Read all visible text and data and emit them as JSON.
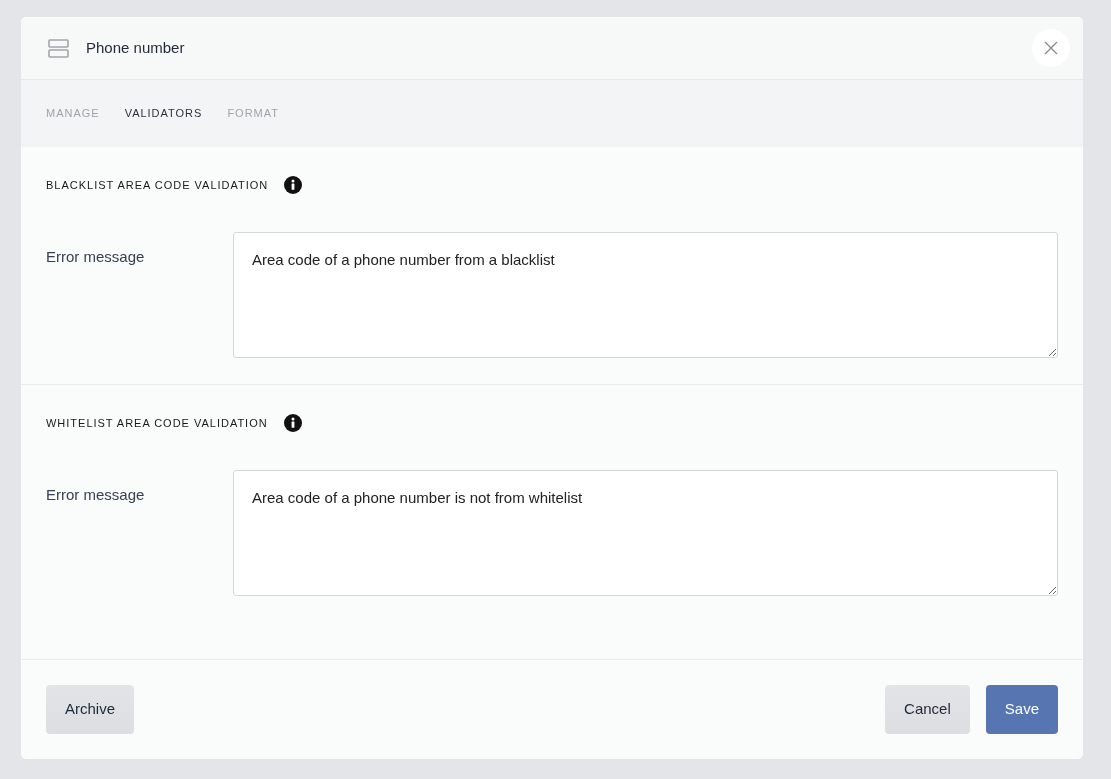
{
  "dialog": {
    "title": "Phone number"
  },
  "tabs": [
    {
      "label": "MANAGE",
      "selected": false
    },
    {
      "label": "VALIDATORS",
      "selected": true
    },
    {
      "label": "FORMAT",
      "selected": false
    }
  ],
  "sections": [
    {
      "title": "BLACKLIST AREA CODE VALIDATION",
      "field_label": "Error message",
      "value": "Area code of a phone number from a blacklist"
    },
    {
      "title": "WHITELIST AREA CODE VALIDATION",
      "field_label": "Error message",
      "value": "Area code of a phone number is not from whitelist"
    }
  ],
  "footer": {
    "left": [
      {
        "label": "Archive",
        "kind": "secondary"
      }
    ],
    "right": [
      {
        "label": "Cancel",
        "kind": "secondary"
      },
      {
        "label": "Save",
        "kind": "primary"
      }
    ]
  }
}
